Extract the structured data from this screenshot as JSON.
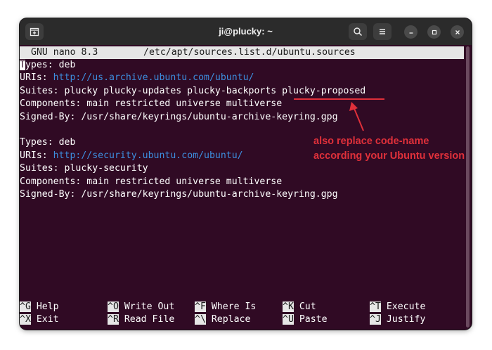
{
  "window": {
    "title": "ji@plucky: ~",
    "icons": {
      "new_tab": "new-tab-icon",
      "search": "search-icon",
      "menu": "hamburger-menu-icon",
      "minimize": "minimize-icon",
      "maximize": "maximize-icon",
      "close": "close-icon"
    }
  },
  "nano": {
    "version": "GNU nano 8.3",
    "filename": "/etc/apt/sources.list.d/ubuntu.sources"
  },
  "file": {
    "block1": {
      "types_cursor": "T",
      "types_rest": "ypes: deb",
      "uris_label": "URIs: ",
      "uris_value": "http://us.archive.ubuntu.com/ubuntu/",
      "suites": "Suites: plucky plucky-updates plucky-backports plucky-proposed",
      "components": "Components: main restricted universe multiverse",
      "signed_by": "Signed-By: /usr/share/keyrings/ubuntu-archive-keyring.gpg"
    },
    "block2": {
      "types": "Types: deb",
      "uris_label": "URIs: ",
      "uris_value": "http://security.ubuntu.com/ubuntu/",
      "suites": "Suites: plucky-security",
      "components": "Components: main restricted universe multiverse",
      "signed_by": "Signed-By: /usr/share/keyrings/ubuntu-archive-keyring.gpg"
    }
  },
  "annotation": {
    "text_line1": "also replace code-name",
    "text_line2": "according your Ubuntu version",
    "color": "#e0303a"
  },
  "shortcuts": [
    {
      "key": "^G",
      "label": "Help"
    },
    {
      "key": "^O",
      "label": "Write Out"
    },
    {
      "key": "^F",
      "label": "Where Is"
    },
    {
      "key": "^K",
      "label": "Cut"
    },
    {
      "key": "^T",
      "label": "Execute"
    },
    {
      "key": "^X",
      "label": "Exit"
    },
    {
      "key": "^R",
      "label": "Read File"
    },
    {
      "key": "^\\",
      "label": "Replace"
    },
    {
      "key": "^U",
      "label": "Paste"
    },
    {
      "key": "^J",
      "label": "Justify"
    }
  ],
  "colors": {
    "terminal_bg": "#300a24",
    "titlebar_bg": "#2b2b2b",
    "url": "#3d8fe0"
  }
}
